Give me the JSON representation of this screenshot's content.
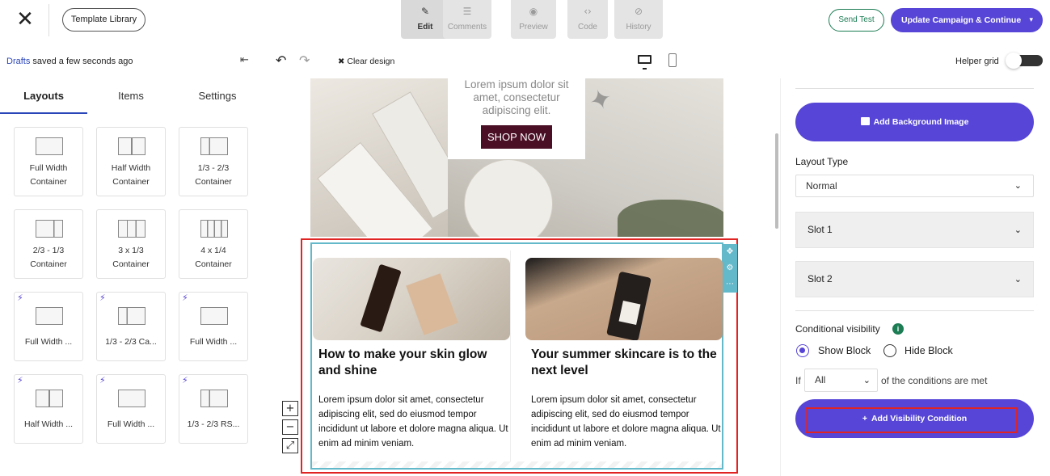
{
  "topbar": {
    "close_icon": "close-x-icon",
    "template_library": "Template Library",
    "modes": [
      {
        "label": "Edit",
        "icon": "pencil-icon",
        "glyph": "✎"
      },
      {
        "label": "Comments",
        "icon": "comment-icon",
        "glyph": "☰"
      },
      {
        "label": "Preview",
        "icon": "eye-icon",
        "glyph": "◉"
      },
      {
        "label": "Code",
        "icon": "code-icon",
        "glyph": "‹›"
      },
      {
        "label": "History",
        "icon": "history-icon",
        "glyph": "⊘"
      }
    ],
    "active_mode": "Edit",
    "send_test": "Send Test",
    "update_campaign": "Update Campaign & Continue"
  },
  "subbar": {
    "drafts_prefix": "Drafts",
    "drafts_status": " saved a few seconds ago",
    "clear_design": "Clear design",
    "helper_grid": "Helper grid"
  },
  "left_panel": {
    "tabs": [
      "Layouts",
      "Items",
      "Settings"
    ],
    "active_tab": "Layouts",
    "tiles": [
      {
        "label": "Full Width Container",
        "lines": [
          "Full Width",
          "Container"
        ],
        "premium": false
      },
      {
        "label": "Half Width Container",
        "lines": [
          "Half Width",
          "Container"
        ],
        "premium": false
      },
      {
        "label": "1/3 - 2/3 Container",
        "lines": [
          "1/3 - 2/3",
          "Container"
        ],
        "premium": false
      },
      {
        "label": "2/3 - 1/3 Container",
        "lines": [
          "2/3 - 1/3",
          "Container"
        ],
        "premium": false
      },
      {
        "label": "3 x 1/3 Container",
        "lines": [
          "3 x 1/3",
          "Container"
        ],
        "premium": false
      },
      {
        "label": "4 x 1/4 Container",
        "lines": [
          "4 x 1/4",
          "Container"
        ],
        "premium": false
      },
      {
        "label": "Full Width ...",
        "lines": [
          "Full Width ..."
        ],
        "premium": true
      },
      {
        "label": "1/3 - 2/3 Ca...",
        "lines": [
          "1/3 - 2/3 Ca..."
        ],
        "premium": true
      },
      {
        "label": "Full Width ...",
        "lines": [
          "Full Width ..."
        ],
        "premium": true
      },
      {
        "label": "Half Width ...",
        "lines": [
          "Half Width ..."
        ],
        "premium": true
      },
      {
        "label": "Full Width ...",
        "lines": [
          "Full Width ..."
        ],
        "premium": true
      },
      {
        "label": "1/3 - 2/3 RS...",
        "lines": [
          "1/3 - 2/3 RS..."
        ],
        "premium": true
      }
    ]
  },
  "canvas": {
    "hero": {
      "text": "Lorem ipsum dolor sit amet, consectetur adipiscing elit.",
      "shop_now": "SHOP NOW"
    },
    "articles": [
      {
        "title": "How to make your skin glow and shine",
        "body": "Lorem ipsum dolor sit amet, consectetur adipiscing elit, sed do eiusmod tempor incididunt ut labore et dolore magna aliqua. Ut enim ad minim veniam."
      },
      {
        "title": "Your summer skincare is to the next level",
        "body": "Lorem ipsum dolor sit amet, consectetur adipiscing elit, sed do eiusmod tempor incididunt ut labore et dolore magna aliqua. Ut enim ad minim veniam."
      }
    ],
    "zoom": {
      "in": "+",
      "out": "−",
      "fit": "⤢"
    }
  },
  "right_panel": {
    "add_background_image": "Add Background Image",
    "layout_type_label": "Layout Type",
    "layout_type_value": "Normal",
    "slots": [
      "Slot 1",
      "Slot 2"
    ],
    "conditional_visibility": "Conditional visibility",
    "info_glyph": "i",
    "show_block": "Show Block",
    "hide_block": "Hide Block",
    "visibility_selected": "Show Block",
    "if_label": "If",
    "condition_match": "All",
    "condition_tail": "of the conditions are met",
    "add_visibility_condition": "Add Visibility Condition"
  },
  "colors": {
    "accent": "#5645d6",
    "send_test_green": "#1c7c54",
    "highlight_red": "#e02424",
    "block_outline": "#63b8c9",
    "shop_button": "#4a0e25"
  }
}
